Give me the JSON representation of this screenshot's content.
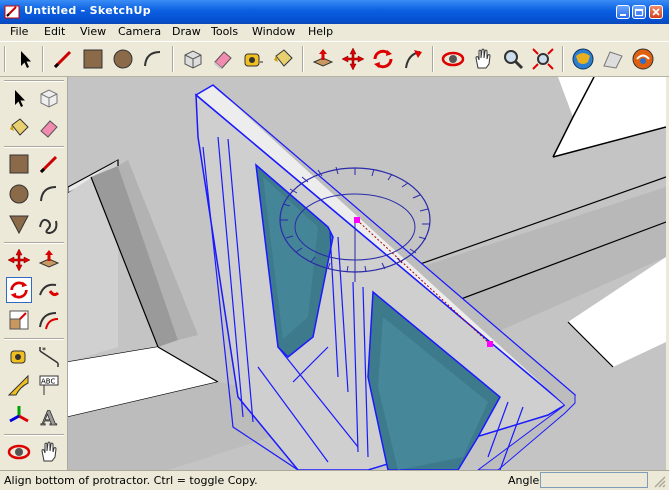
{
  "window": {
    "title": "Untitled - SketchUp"
  },
  "menu": [
    "File",
    "Edit",
    "View",
    "Camera",
    "Draw",
    "Tools",
    "Window",
    "Help"
  ],
  "status": {
    "message": "Align bottom of protractor.  Ctrl = toggle Copy.",
    "vcb_label": "Angle",
    "vcb_value": ""
  },
  "colors": {
    "title_bar": "#0653d4",
    "chrome": "#ece9d8",
    "wall_gray": "#bdbdbd",
    "floor_gray": "#a8a8a8",
    "selection_blue": "#1a1aff",
    "inference_magenta": "#ff00ff",
    "glass": "#3d7a8c"
  },
  "toolbar_icons": [
    "select-icon",
    "line-icon",
    "rectangle-icon",
    "circle-icon",
    "arc-icon",
    "make-component-icon",
    "eraser-icon",
    "tape-measure-icon",
    "paint-bucket-icon",
    "push-pull-icon",
    "move-icon",
    "rotate-icon",
    "follow-me-icon",
    "orbit-icon",
    "pan-icon",
    "zoom-icon",
    "zoom-extents-icon",
    "get-models-icon",
    "previous-view-icon",
    "next-view-icon"
  ]
}
